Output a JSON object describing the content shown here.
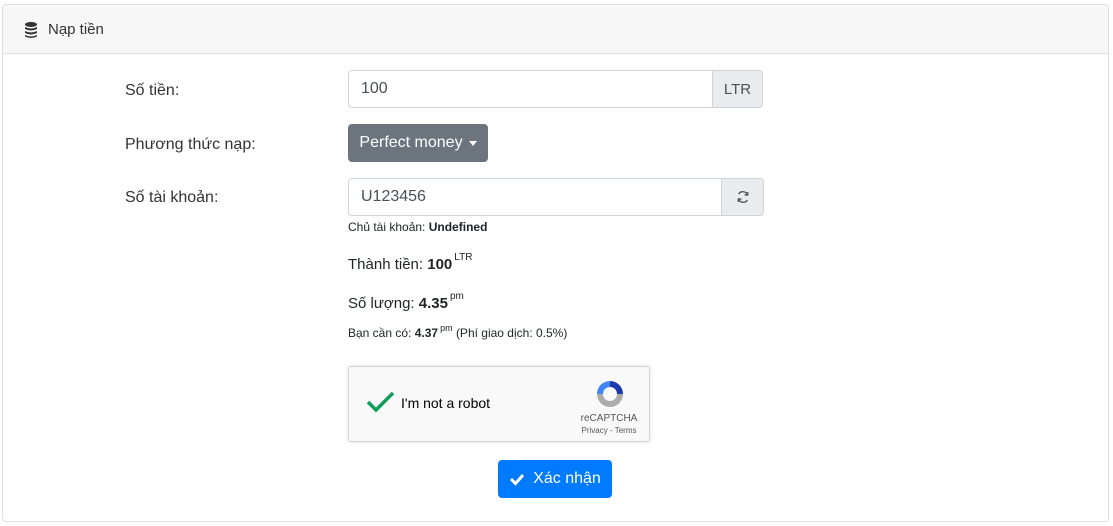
{
  "header": {
    "title": "Nạp tiền",
    "icon": "coins-icon"
  },
  "form": {
    "amount": {
      "label": "Số tiền:",
      "value": "100",
      "unit": "LTR"
    },
    "method": {
      "label": "Phương thức nạp:",
      "selected": "Perfect money"
    },
    "account": {
      "label": "Số tài khoản:",
      "value": "U123456",
      "refresh_icon": "refresh-icon"
    },
    "owner": {
      "label": "Chủ tài khoản:",
      "value": "Undefined"
    },
    "total": {
      "label": "Thành tiền:",
      "value": "100",
      "unit": "LTR"
    },
    "quantity": {
      "label": "Số lượng:",
      "value": "4.35",
      "unit": "pm"
    },
    "need": {
      "label": "Bạn cần có:",
      "value": "4.37",
      "unit": "pm",
      "fee": "(Phí giao dịch: 0.5%)"
    }
  },
  "recaptcha": {
    "label": "I'm not a robot",
    "brand": "reCAPTCHA",
    "privacy": "Privacy",
    "sep": " - ",
    "terms": "Terms",
    "checked": true
  },
  "submit": {
    "label": "Xác nhận",
    "icon": "check-icon"
  },
  "colors": {
    "primary": "#007bff",
    "secondary": "#6c757d",
    "check": "#0f9d58"
  }
}
